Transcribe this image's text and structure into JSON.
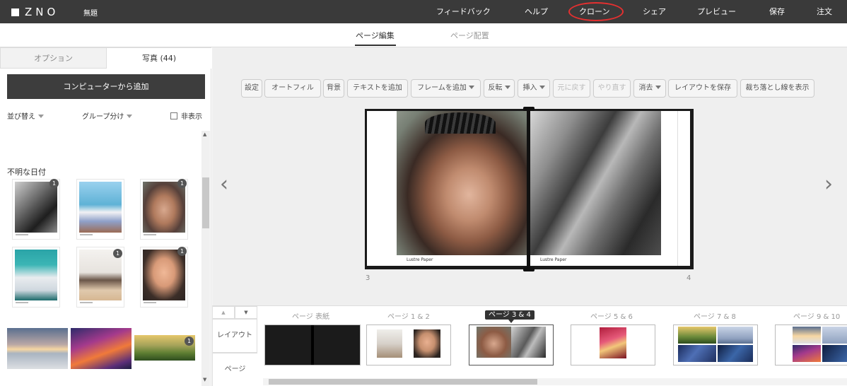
{
  "header": {
    "logo_text": "ZNO",
    "doc_title": "無題",
    "nav": [
      "フィードバック",
      "ヘルプ",
      "クローン",
      "シェア",
      "プレビュー",
      "保存",
      "注文"
    ],
    "highlight_color": "#e53030"
  },
  "subtabs": [
    "ページ編集",
    "ページ配置"
  ],
  "left_panel": {
    "tab_options": "オプション",
    "tab_photos": "写真 (44)",
    "add_button": "コンピューターから追加",
    "sort_label": "並び替え",
    "group_label": "グループ分け",
    "hide_label": "非表示",
    "date_header": "不明な日付",
    "badges": [
      "1",
      "1",
      "1",
      "1",
      "1"
    ]
  },
  "toolbar": [
    "設定",
    "オートフィル",
    "背景",
    "テキストを追加",
    "フレームを追加",
    "反転",
    "挿入",
    "元に戻す",
    "やり直す",
    "消去",
    "レイアウトを保存",
    "裁ち落とし線を表示"
  ],
  "spread": {
    "left_caption": "Lustre Paper",
    "right_caption": "Lustre Paper",
    "left_page_number": "3",
    "right_page_number": "4"
  },
  "bottom": {
    "layout_label": "レイアウト",
    "page_label": "ページ",
    "pages": [
      "ページ 表紙",
      "ページ 1 & 2",
      "ページ 3 & 4",
      "ページ 5 & 6",
      "ページ 7 & 8",
      "ページ 9 & 10"
    ],
    "active_page": "ページ 3 & 4"
  }
}
